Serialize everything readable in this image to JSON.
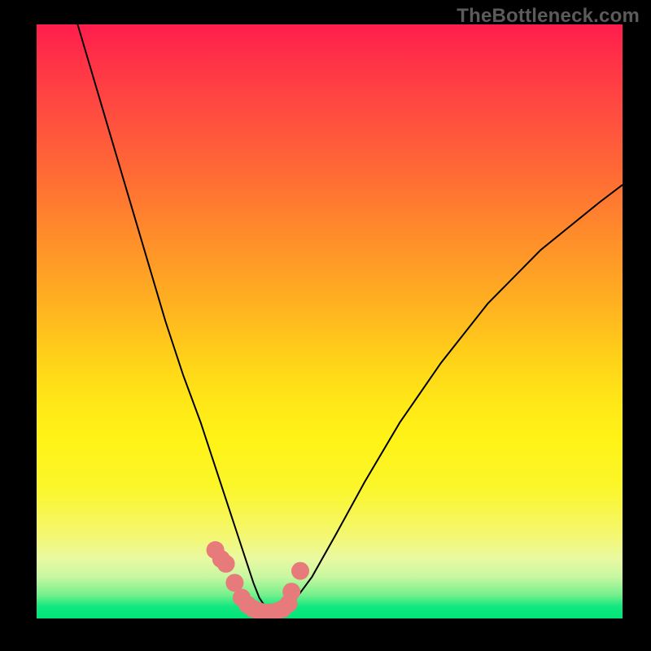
{
  "watermark": "TheBottleneck.com",
  "chart_data": {
    "type": "line",
    "title": "",
    "xlabel": "",
    "ylabel": "",
    "xlim": [
      0,
      100
    ],
    "ylim": [
      0,
      100
    ],
    "grid": false,
    "legend": false,
    "series": [
      {
        "name": "curve",
        "x": [
          7,
          10,
          13,
          16,
          19,
          22,
          25,
          28,
          30,
          32,
          34,
          36,
          37,
          38,
          39,
          40,
          41,
          42,
          44,
          47,
          51,
          56,
          62,
          69,
          77,
          86,
          96,
          100
        ],
        "y": [
          100,
          90,
          80,
          70,
          60,
          50,
          41,
          33,
          27,
          21,
          15,
          9,
          6,
          3.5,
          2,
          1,
          1,
          1.5,
          3,
          7,
          14,
          23,
          33,
          43,
          53,
          62,
          70,
          73
        ]
      },
      {
        "name": "markers",
        "x": [
          30.5,
          31.5,
          32.3,
          33.8,
          35.0,
          36.0,
          37.0,
          38.0,
          39.0,
          40.0,
          41.0,
          42.0,
          43.0,
          43.5,
          45.0
        ],
        "y": [
          11.5,
          10.0,
          9.2,
          6.0,
          3.5,
          2.3,
          1.6,
          1.2,
          1.0,
          1.0,
          1.2,
          1.6,
          2.5,
          4.5,
          8.0
        ]
      }
    ],
    "colors": {
      "curve": "#000000",
      "markers": "#e77a7a",
      "background_top": "#ff1d4d",
      "background_bottom": "#00e47a"
    }
  }
}
